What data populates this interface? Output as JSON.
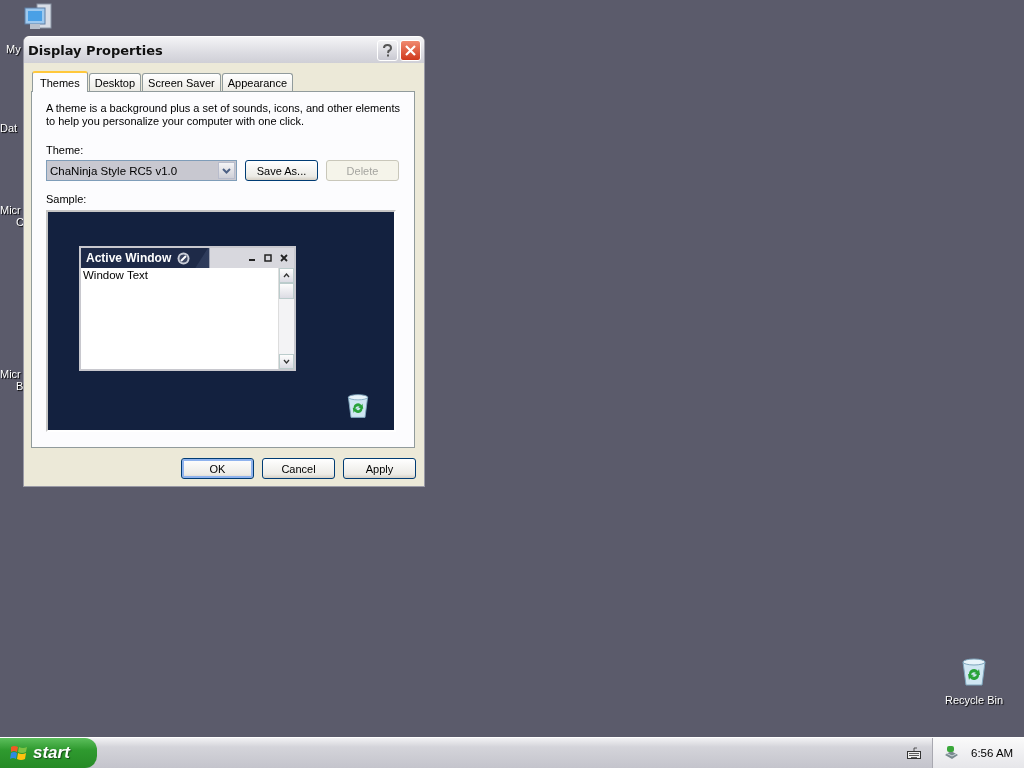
{
  "desktop_icons": [
    {
      "kind": "computer",
      "lines": [
        "My"
      ]
    },
    {
      "kind": "hidden",
      "lines": [
        "Dat"
      ]
    },
    {
      "kind": "hidden",
      "lines": [
        "Micr",
        "C"
      ]
    },
    {
      "kind": "hidden",
      "lines": [
        "Micr",
        "B"
      ]
    },
    {
      "kind": "recycle",
      "lines": [
        "Recycle Bin"
      ]
    }
  ],
  "window": {
    "title": "Display Properties",
    "tabs": [
      {
        "label": "Themes",
        "selected": true
      },
      {
        "label": "Desktop",
        "selected": false
      },
      {
        "label": "Screen Saver",
        "selected": false
      },
      {
        "label": "Appearance",
        "selected": false
      }
    ],
    "description": "A theme is a background plus a set of sounds, icons, and other elements to help you personalize your computer with one click.",
    "theme_label": "Theme:",
    "theme_select": {
      "value": "ChaNinja Style RC5 v1.0"
    },
    "theme_buttons": [
      {
        "label": "Save As...",
        "disabled": false
      },
      {
        "label": "Delete",
        "disabled": true
      }
    ],
    "sample_label": "Sample:",
    "sample": {
      "window_title": "Active Window",
      "window_text": "Window Text"
    },
    "buttons": [
      {
        "label": "OK",
        "default": true
      },
      {
        "label": "Cancel",
        "default": false
      },
      {
        "label": "Apply",
        "default": false
      }
    ]
  },
  "taskbar": {
    "start": "start",
    "clock": "6:56 AM"
  }
}
